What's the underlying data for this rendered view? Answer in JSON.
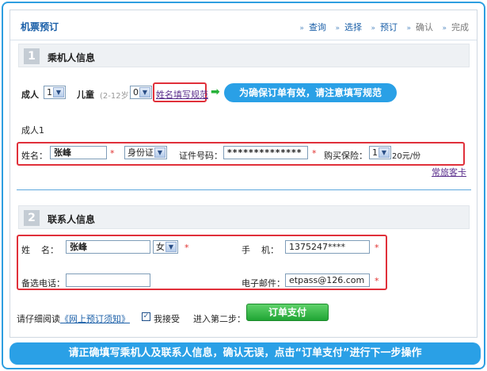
{
  "header": {
    "title": "机票预订",
    "steps": [
      {
        "label": "查询"
      },
      {
        "label": "选择"
      },
      {
        "label": "预订"
      },
      {
        "label": "确认"
      },
      {
        "label": "完成"
      }
    ]
  },
  "section1": {
    "number": "1",
    "title": "乘机人信息",
    "adult_label": "成人",
    "adult_count": "1",
    "child_label": "儿童",
    "child_age": "(2-12岁)",
    "child_count": "0",
    "rules_link": "姓名填写规范",
    "tip": "为确保订单有效，请注意填写规范",
    "passenger_heading": "成人1",
    "name_label": "姓名：",
    "name_value": "张峰",
    "id_type": "身份证",
    "id_label": "证件号码：",
    "id_value": "**************",
    "insurance_label": "购买保险：",
    "insurance_value": "1",
    "insurance_price": "20元/份",
    "frequent_link": "常旅客卡"
  },
  "section2": {
    "number": "2",
    "title": "联系人信息",
    "name_label": "姓    名：",
    "name_value": "张峰",
    "gender_value": "女",
    "mobile_label": "手    机：",
    "mobile_value": "1375247****",
    "alt_phone_label": "备选电话：",
    "alt_phone_value": "",
    "email_label": "电子邮件：",
    "email_value": "etpass@126.com"
  },
  "footer": {
    "read_prefix": "请仔细阅读",
    "notice_link": "《网上预订须知》",
    "accept_label": "我接受",
    "next_label": "进入第二步：",
    "submit_label": "订单支付"
  },
  "bottom_banner": "请正确填写乘机人及联系人信息，确认无误，点击“订单支付”进行下一步操作",
  "colors": {
    "frame_blue": "#2e9ee0",
    "banner_blue": "#2aa0e6",
    "highlight_red": "#e0303a",
    "button_green": "#20a534"
  }
}
